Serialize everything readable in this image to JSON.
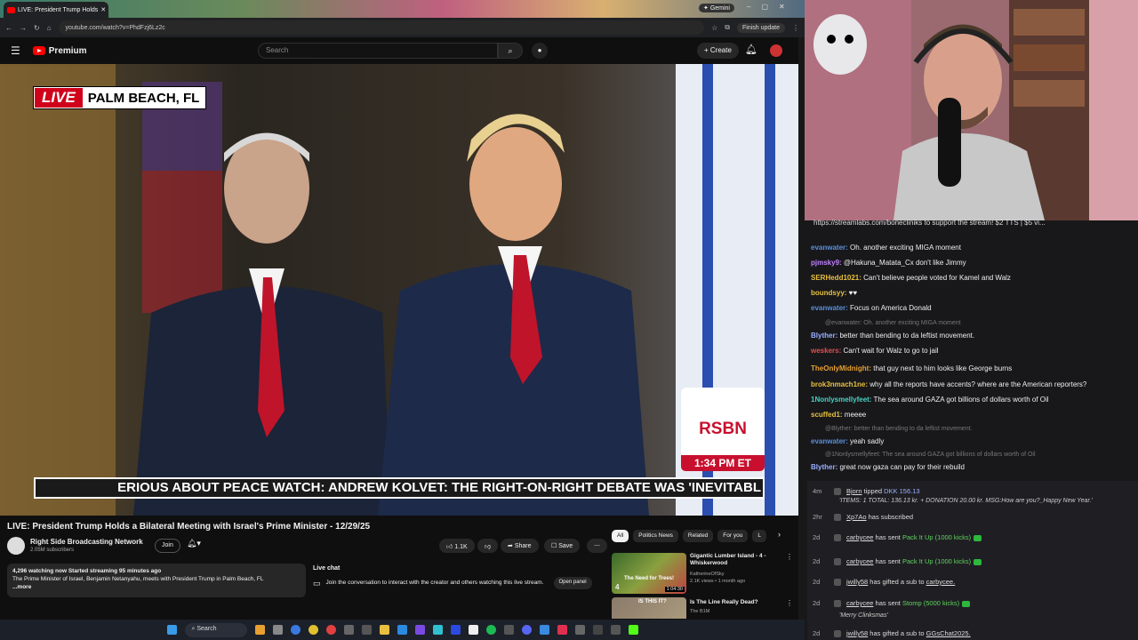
{
  "browser": {
    "tab_title": "LIVE: President Trump Holds",
    "gemini_label": "Gemini",
    "url": "youtube.com/watch?v=PhdFzj6Lz2c",
    "finish_update": "Finish update"
  },
  "youtube": {
    "logo_text": "Premium",
    "search_placeholder": "Search",
    "create_label": "Create",
    "video": {
      "live_label": "LIVE",
      "location": "PALM BEACH, FL",
      "ticker": "ERIOUS ABOUT PEACE   WATCH: ANDREW KOLVET: THE RIGHT-ON-RIGHT DEBATE WAS 'INEVITABL",
      "rsbn_logo": "RSBN",
      "rsbn_time": "1:34 PM ET"
    },
    "title": "LIVE: President Trump Holds a Bilateral Meeting with Israel's Prime Minister - 12/29/25",
    "channel": {
      "name": "Right Side Broadcasting Network",
      "subscribers": "2.05M subscribers",
      "join_label": "Join"
    },
    "actions": {
      "likes": "1.1K",
      "share": "Share",
      "save": "Save"
    },
    "description": {
      "stats": "4,296 watching now  Started streaming 95 minutes ago",
      "text": "The Prime Minister of Israel, Benjamin Netanyahu, meets with President Trump in Palm Beach, FL",
      "more": "...more"
    },
    "live_chat": {
      "header": "Live chat",
      "text": "Join the conversation to interact with the creator and others watching this live stream.",
      "open_panel": "Open panel"
    },
    "filters": [
      "All",
      "Politics News",
      "Related",
      "For you",
      "L"
    ],
    "recommendations": [
      {
        "title": "Gigantic Lumber Island - 4 - Whiskerwood",
        "channel": "KatherineOfSky",
        "meta": "2.1K views • 1 month ago",
        "duration": "1:04:30",
        "thumb_text": "The Need for Trees!",
        "index": "4"
      },
      {
        "title": "Is The Line Really Dead?",
        "channel": "The B1M",
        "meta": "",
        "duration": "",
        "thumb_text": "IS THIS IT?",
        "index": ""
      }
    ]
  },
  "taskbar": {
    "search": "Search"
  },
  "stream_chat": {
    "pinned": "https://streamlabs.com/bonecliniks to support the stream! $2 TTS | $5 vi...",
    "messages": [
      {
        "user": "evanwater:",
        "color": "#5b8fd6",
        "text": " Oh. another exciting MIGA moment"
      },
      {
        "user": "pjmsky9:",
        "color": "#c080ff",
        "text": " @Hakuna_Matata_Cx don't like Jimmy"
      },
      {
        "user": "SERHedd1021:",
        "color": "#e8c040",
        "text": " Can't believe people voted for Kamel and Walz"
      },
      {
        "user": "boundsyy:",
        "color": "#e8c040",
        "text": " ♥♥"
      },
      {
        "user": "evanwater:",
        "color": "#5b8fd6",
        "text": " Focus on America Donald"
      },
      {
        "reply": "@evanwater: Oh. another exciting MIGA moment"
      },
      {
        "user": "Blyther:",
        "color": "#9ab0ff",
        "text": " better than bending to da leftist movement."
      },
      {
        "user": "weskers:",
        "color": "#e05050",
        "text": " Can't wait for Walz to go to jail"
      },
      {
        "user": "TheOnlyMidnight:",
        "color": "#e8a030",
        "text": " that guy next to him looks like George burns"
      },
      {
        "user": "brok3nmach1ne:",
        "color": "#e8c040",
        "text": " why all the reports have accents? where are the American reporters?"
      },
      {
        "user": "1Nonlysmellyfeet:",
        "color": "#4ad0c0",
        "text": " The sea around GAZA got billions of dollars worth of Oil"
      },
      {
        "user": "scuffed1:",
        "color": "#e8c040",
        "text": " meeee"
      },
      {
        "reply": "@Blyther: better than bending to da leftist movement."
      },
      {
        "user": "evanwater:",
        "color": "#5b8fd6",
        "text": " yeah sadly"
      },
      {
        "reply": "@1Nonlysmellyfeet: The sea around GAZA got billions of dollars worth of Oil"
      },
      {
        "user": "Blyther:",
        "color": "#9ab0ff",
        "text": " great now gaza can pay for their rebuild"
      }
    ],
    "events": [
      {
        "ts": "4m",
        "user": "Bjorn",
        "text": " tipped ",
        "amount": "DKK 156.13",
        "sub": "'ITEMS: 1 TOTAL: 136.13 kr. + DONATION 20.00 kr. MSG:How are you?_Happy New Year.'"
      },
      {
        "ts": "2hr",
        "user": "Xp7Ao",
        "text": " has subscribed"
      },
      {
        "ts": "2d",
        "user": "carbycee",
        "text": " has sent ",
        "amount": "Pack It Up (1000 kicks)"
      },
      {
        "ts": "2d",
        "user": "carbycee",
        "text": " has sent ",
        "amount": "Pack It Up (1000 kicks)"
      },
      {
        "ts": "2d",
        "user": "jwilly58",
        "text": " has gifted a sub to ",
        "target": "carbycee."
      },
      {
        "ts": "2d",
        "user": "carbycee",
        "text": " has sent ",
        "amount": "Stomp (5000 kicks)",
        "sub": "'Merry Clinksmas'"
      },
      {
        "ts": "2d",
        "user": "jwilly58",
        "text": " has gifted a sub to ",
        "target": "GGsChat2025."
      }
    ]
  }
}
